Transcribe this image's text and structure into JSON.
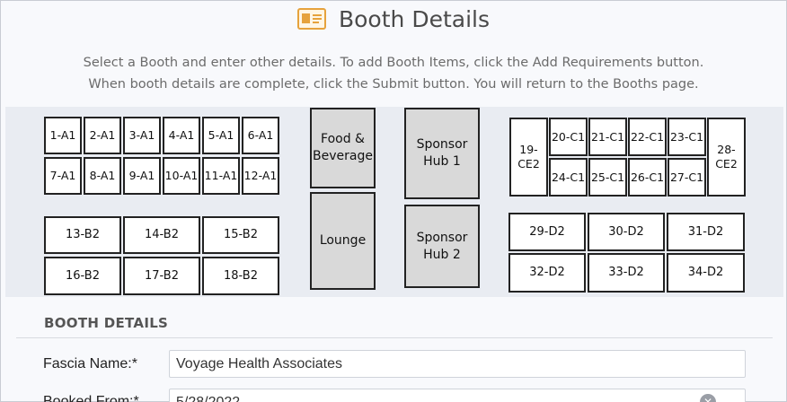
{
  "header": {
    "title": "Booth Details",
    "icon": "id-card-icon",
    "icon_color": "#e6a23c"
  },
  "instructions": {
    "line1": "Select a Booth and enter other details. To add Booth Items, click the Add Requirements button.",
    "line2": "When booth details are complete, click the Submit button. You will return to the Booths page."
  },
  "floorplan": {
    "booths_a": [
      "1-A1",
      "2-A1",
      "3-A1",
      "4-A1",
      "5-A1",
      "6-A1",
      "7-A1",
      "8-A1",
      "9-A1",
      "10-A1",
      "11-A1",
      "12-A1"
    ],
    "booths_b": [
      "13-B2",
      "14-B2",
      "15-B2",
      "16-B2",
      "17-B2",
      "18-B2"
    ],
    "booths_c": [
      "20-C1",
      "21-C1",
      "22-C1",
      "23-C1",
      "24-C1",
      "25-C1",
      "26-C1",
      "27-C1"
    ],
    "booths_ce": [
      "19-\nCE2",
      "28-\nCE2"
    ],
    "booths_d": [
      "29-D2",
      "30-D2",
      "31-D2",
      "32-D2",
      "33-D2",
      "34-D2"
    ],
    "special": {
      "food": "Food &\nBeverage",
      "lounge": "Lounge",
      "hub1": "Sponsor\nHub 1",
      "hub2": "Sponsor\nHub 2"
    }
  },
  "form": {
    "section_title": "BOOTH DETAILS",
    "fascia_label": "Fascia Name:*",
    "fascia_value": "Voyage Health Associates",
    "booked_from_label": "Booked From:*",
    "booked_from_value": "5/28/2022"
  }
}
